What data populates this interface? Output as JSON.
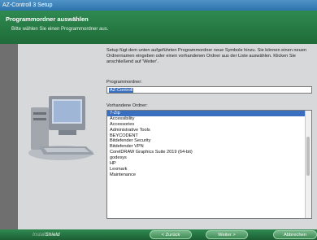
{
  "window": {
    "title": "AZ-Controll 3 Setup"
  },
  "header": {
    "title": "Programmordner auswählen",
    "subtitle": "Bitte wählen Sie einen Programmordner aus."
  },
  "content": {
    "description": "Setup fügt dem unten aufgeführten Programmordner neue Symbole hinzu. Sie können einen neuen Ordnernamen eingeben oder einen vorhandenen Ordner aus der Liste auswählen. Klicken Sie anschließend auf 'Weiter'.",
    "program_folder_label": "Programmordner:",
    "program_folder_value": "AZ-Controll",
    "existing_folders_label": "Vorhandene Ordner:",
    "folders": [
      "7-Zip",
      "Accessibility",
      "Accessories",
      "Administrative Tools",
      "BEYCODENT",
      "Bitdefender Security",
      "Bitdefender VPN",
      "CorelDRAW Graphics Suite 2019 (64-bit)",
      "godesys",
      "HP",
      "Lexmark",
      "Maintenance"
    ],
    "selected_folder_index": 0
  },
  "footer": {
    "brand_a": "Install",
    "brand_b": "Shield",
    "back_label": "< Zurück",
    "next_label": "Weiter >",
    "cancel_label": "Abbrechen"
  }
}
